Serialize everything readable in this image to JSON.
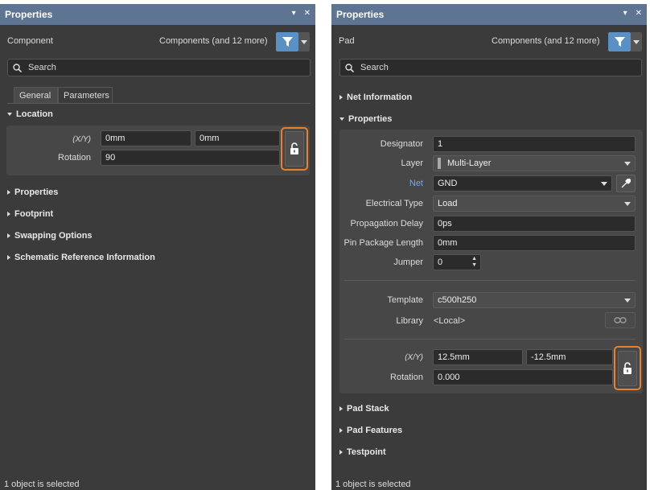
{
  "left": {
    "title": "Properties",
    "object_type": "Component",
    "filter_text": "Components (and 12 more)",
    "search_placeholder": "Search",
    "tabs": [
      "General",
      "Parameters"
    ],
    "location_section": "Location",
    "xy_label": "(X/Y)",
    "x_value": "0mm",
    "y_value": "0mm",
    "rotation_label": "Rotation",
    "rotation_value": "90",
    "sections": [
      "Properties",
      "Footprint",
      "Swapping Options",
      "Schematic Reference Information"
    ],
    "status": "1 object is selected"
  },
  "right": {
    "title": "Properties",
    "object_type": "Pad",
    "filter_text": "Components (and 12 more)",
    "search_placeholder": "Search",
    "net_information_section": "Net Information",
    "properties_section": "Properties",
    "fields": {
      "designator_label": "Designator",
      "designator_value": "1",
      "layer_label": "Layer",
      "layer_value": "Multi-Layer",
      "net_label": "Net",
      "net_value": "GND",
      "electrical_type_label": "Electrical Type",
      "electrical_type_value": "Load",
      "propagation_delay_label": "Propagation Delay",
      "propagation_delay_value": "0ps",
      "pin_package_length_label": "Pin Package Length",
      "pin_package_length_value": "0mm",
      "jumper_label": "Jumper",
      "jumper_value": "0",
      "template_label": "Template",
      "template_value": "c500h250",
      "library_label": "Library",
      "library_value": "<Local>",
      "xy_label": "(X/Y)",
      "x_value": "12.5mm",
      "y_value": "-12.5mm",
      "rotation_label": "Rotation",
      "rotation_value": "0.000"
    },
    "sections_bottom": [
      "Pad Stack",
      "Pad Features",
      "Testpoint"
    ],
    "status": "1 object is selected"
  },
  "colors": {
    "title_bar": "#5d7593",
    "panel_bg": "#3b3b3b",
    "highlight_orange": "#e8822a",
    "filter_blue": "#5b90c4",
    "layer_swatch": "#a9a9a9",
    "net_label_blue": "#7aa7e6"
  },
  "icons": [
    "pin-icon",
    "close-icon",
    "filter-icon",
    "search-icon",
    "unlock-icon",
    "eyedropper-icon",
    "link-icon"
  ]
}
